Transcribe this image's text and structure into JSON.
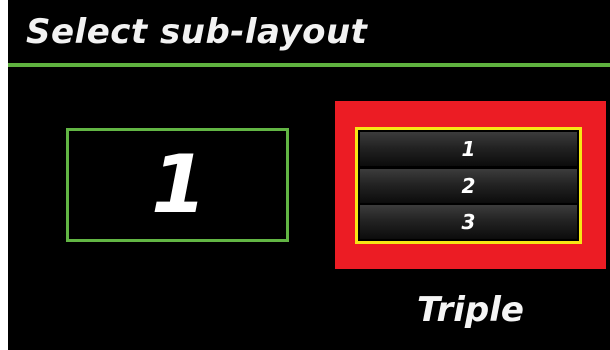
{
  "header": {
    "title": "Select sub-layout"
  },
  "options": [
    {
      "number": "1",
      "selected": false
    },
    {
      "rows": [
        "1",
        "2",
        "3"
      ],
      "label": "Triple",
      "selected": true
    }
  ],
  "colors": {
    "background": "#000000",
    "accent_green": "#5fb23f",
    "selection_red": "#ec1c24",
    "highlight_yellow": "#f6e716",
    "text": "#ffffff"
  }
}
